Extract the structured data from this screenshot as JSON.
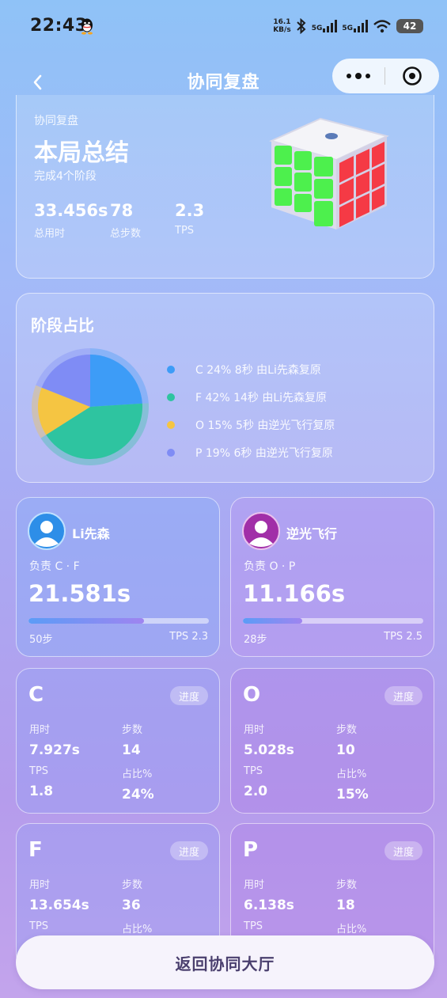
{
  "status_bar": {
    "time": "22:43",
    "net_speed_value": "16.1",
    "net_speed_unit": "KB/s",
    "sig1": "5G",
    "sig2": "5G",
    "battery": "42"
  },
  "nav": {
    "title": "协同复盘"
  },
  "summary": {
    "eyebrow": "协同复盘",
    "title": "本局总结",
    "subtitle": "完成4个阶段",
    "stats": [
      {
        "value": "33.456s",
        "label": "总用时"
      },
      {
        "value": "78",
        "label": "总步数"
      },
      {
        "value": "2.3",
        "label": "TPS"
      }
    ]
  },
  "phase_share": {
    "title": "阶段占比",
    "items": [
      {
        "text": "C 24% 8秒 由Li先森复原",
        "color": "#3d9cf7",
        "percent": 24
      },
      {
        "text": "F 42% 14秒 由Li先森复原",
        "color": "#2ec4a0",
        "percent": 42
      },
      {
        "text": "O 15% 5秒 由逆光飞行复原",
        "color": "#f5c542",
        "percent": 15
      },
      {
        "text": "P 19% 6秒 由逆光飞行复原",
        "color": "#7f8cf5",
        "percent": 19
      }
    ]
  },
  "players": [
    {
      "name": "Li先森",
      "resp": "负责 C · F",
      "time": "21.581s",
      "progress": 0.64,
      "steps": "50步",
      "tps": "TPS 2.3"
    },
    {
      "name": "逆光飞行",
      "resp": "负责 O · P",
      "time": "11.166s",
      "progress": 0.33,
      "steps": "28步",
      "tps": "TPS 2.5"
    }
  ],
  "phases": [
    {
      "letter": "C",
      "chip": "进度",
      "time_label": "用时",
      "time": "7.927s",
      "steps_label": "步数",
      "steps": "14",
      "tps_label": "TPS",
      "tps": "1.8",
      "share_label": "占比%",
      "share": "24%"
    },
    {
      "letter": "O",
      "chip": "进度",
      "time_label": "用时",
      "time": "5.028s",
      "steps_label": "步数",
      "steps": "10",
      "tps_label": "TPS",
      "tps": "2.0",
      "share_label": "占比%",
      "share": "15%"
    },
    {
      "letter": "F",
      "chip": "进度",
      "time_label": "用时",
      "time": "13.654s",
      "steps_label": "步数",
      "steps": "36",
      "tps_label": "TPS",
      "tps_partial": "",
      "share_label": "占比%"
    },
    {
      "letter": "P",
      "chip": "进度",
      "time_label": "用时",
      "time": "6.138s",
      "steps_label": "步数",
      "steps": "18",
      "tps_label": "TPS",
      "share_label": "占比%"
    }
  ],
  "footer": {
    "return_label": "返回协同大厅"
  }
}
